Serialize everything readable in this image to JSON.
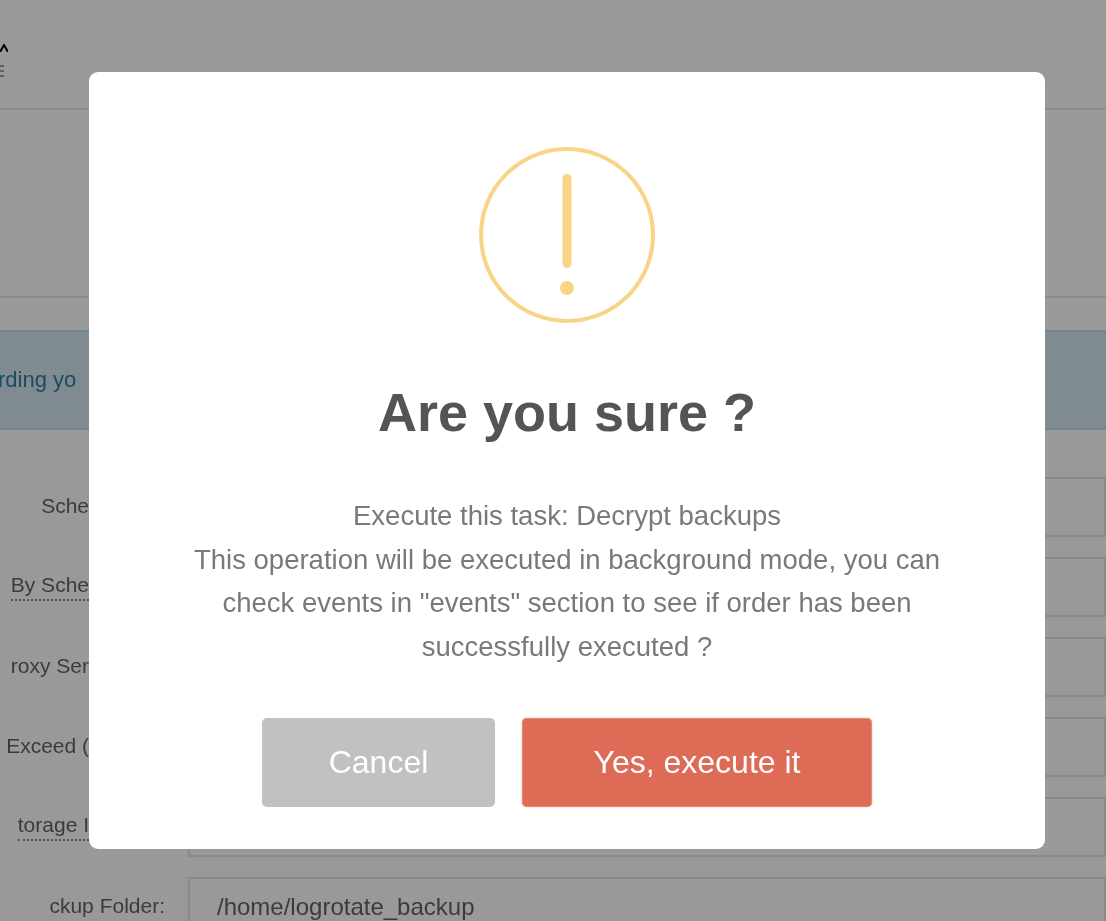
{
  "banner": {
    "text": "rding yo"
  },
  "form_rows": [
    {
      "label": "Sche",
      "underlined": false
    },
    {
      "label": "By Sche",
      "underlined": true
    },
    {
      "label": "roxy Ser",
      "underlined": false
    },
    {
      "label": "Exceed (",
      "underlined": false
    },
    {
      "label": "torage I",
      "underlined": true
    },
    {
      "label": "ckup Folder:",
      "underlined": false,
      "value": "/home/logrotate_backup"
    }
  ],
  "dialog": {
    "title": "Are you sure ?",
    "message": [
      "Execute this task: Decrypt backups",
      "This operation will be executed in background mode, you can check events in \"events\" section to see if order has been successfully executed ?"
    ],
    "buttons": [
      {
        "kind": "cancel",
        "label": "Cancel"
      },
      {
        "kind": "confirm",
        "label": "Yes, execute it"
      }
    ]
  }
}
